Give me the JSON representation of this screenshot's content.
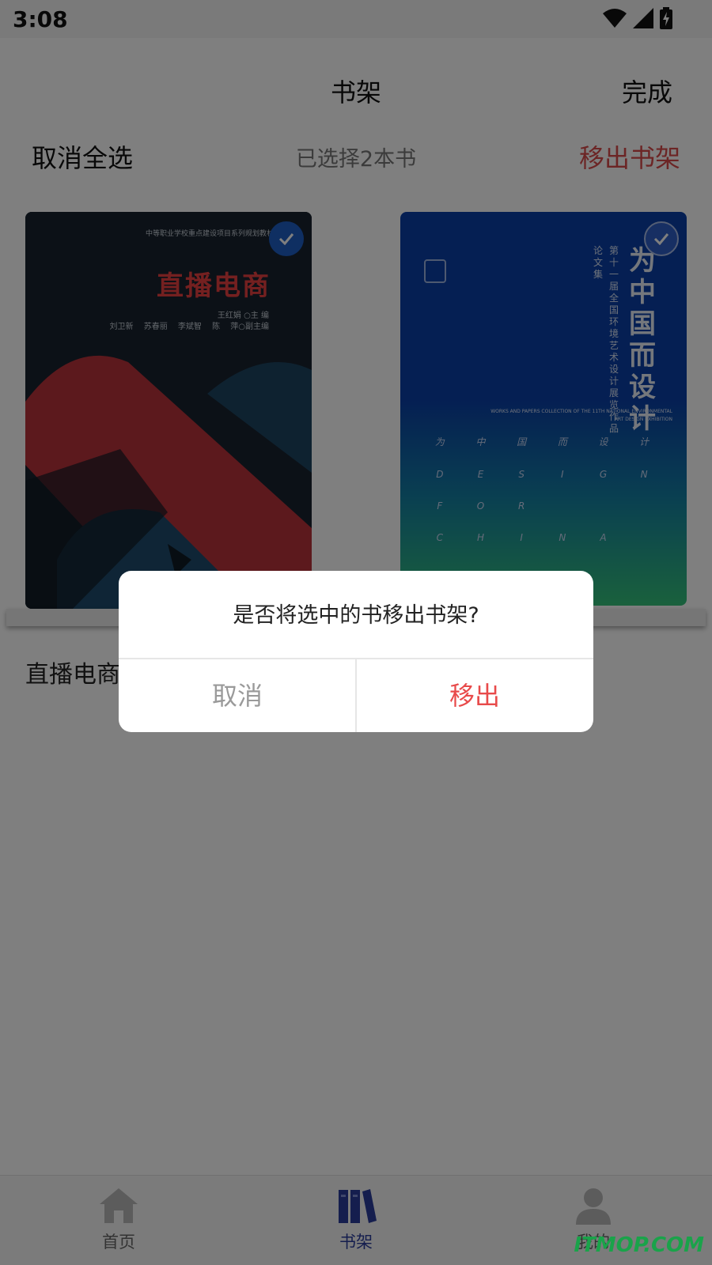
{
  "status": {
    "time": "3:08"
  },
  "nav": {
    "title": "书架",
    "done": "完成"
  },
  "actions": {
    "deselect_all": "取消全选",
    "selected_count": "已选择2本书",
    "remove": "移出书架"
  },
  "books": [
    {
      "title": "直播电商",
      "selected": true,
      "cover": {
        "series": "中等职业学校重点建设项目系列规划教材",
        "title": "直播电商",
        "editor": "王红娟 ○主 编",
        "authors": "刘卫新 苏春丽 李斌智 陈 萍○副主编"
      }
    },
    {
      "selected": true,
      "cover": {
        "title": "为中国而设计",
        "subtitle": "第十一届全国环境艺术设计展览作品",
        "subtitle2": "论文集",
        "english": "WORKS AND PAPERS COLLECTION OF THE 11TH NATIONAL ENVIRONMENTAL ART DESIGN EXHIBITION",
        "letters": [
          "为",
          "中",
          "国",
          "而",
          "设",
          "计",
          "D",
          "E",
          "S",
          "I",
          "G",
          "N",
          "F",
          "O",
          "R",
          "",
          "",
          "",
          "C",
          "H",
          "I",
          "N",
          "A",
          ""
        ]
      }
    }
  ],
  "dialog": {
    "message": "是否将选中的书移出书架?",
    "cancel": "取消",
    "confirm": "移出"
  },
  "tabs": [
    {
      "label": "首页",
      "icon": "home-icon"
    },
    {
      "label": "书架",
      "icon": "bookshelf-icon",
      "active": true
    },
    {
      "label": "我的",
      "icon": "user-icon"
    }
  ],
  "watermark": "ITMOP.COM",
  "colors": {
    "accent_red": "#d94b4b",
    "tab_active": "#2a3d9c",
    "check_blue": "#1f5fc4"
  }
}
